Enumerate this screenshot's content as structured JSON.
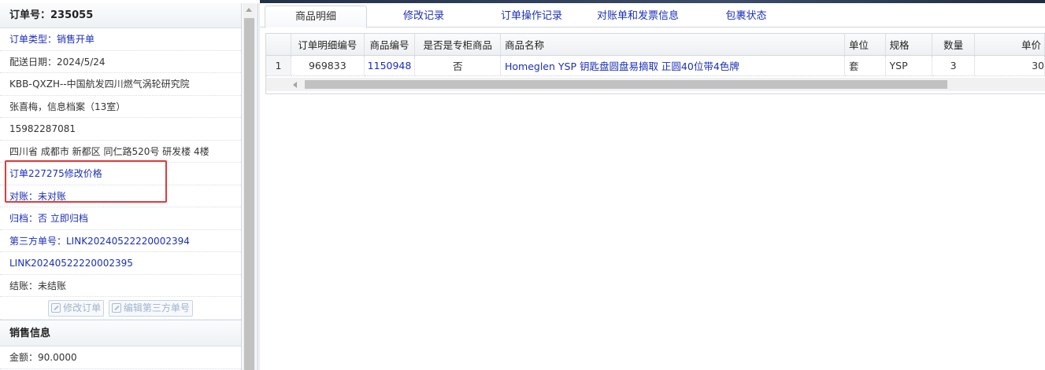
{
  "left": {
    "order_number": "订单号：235055",
    "rows": [
      {
        "text": "订单类型：销售开单",
        "style": "blue"
      },
      {
        "text": "配送日期：2024/5/24",
        "style": "plain"
      },
      {
        "text": "KBB-QXZH--中国航发四川燃气涡轮研究院",
        "style": "plain"
      },
      {
        "text": "张喜梅，信息档案（13室）",
        "style": "plain"
      },
      {
        "text": "15982287081",
        "style": "plain"
      },
      {
        "text": "四川省 成都市 新都区 同仁路520号 研发楼 4楼",
        "style": "plain"
      },
      {
        "text": "订单227275修改价格",
        "style": "blue"
      },
      {
        "text": "对账：未对账",
        "style": "blue"
      }
    ],
    "archive_label": "归档：否",
    "archive_link": "立即归档",
    "third_party_label": "第三方单号：LINK20240522220002394",
    "third_party_second": "LINK20240522220002395",
    "settlement": "结账：未结账",
    "buttons": {
      "modify_order": "修改订单",
      "edit_third_party": "编辑第三方单号"
    },
    "section_title": "销售信息",
    "amount": "金额：90.0000"
  },
  "tabs": [
    "商品明细",
    "修改记录",
    "订单操作记录",
    "对账单和发票信息",
    "包裹状态"
  ],
  "table": {
    "headers": [
      "",
      "订单明细编号",
      "商品编号",
      "是否是专柜商品",
      "商品名称",
      "单位",
      "规格",
      "数量",
      "单价"
    ],
    "rows": [
      [
        "1",
        "969833",
        "1150948",
        "否",
        "Homeglen YSP 钥匙盘圆盘易摘取 正圆40位带4色牌",
        "套",
        "YSP",
        "3",
        "30"
      ]
    ]
  },
  "colors": {
    "link": "#1a2fb8",
    "highlight": "#e03a3a"
  }
}
